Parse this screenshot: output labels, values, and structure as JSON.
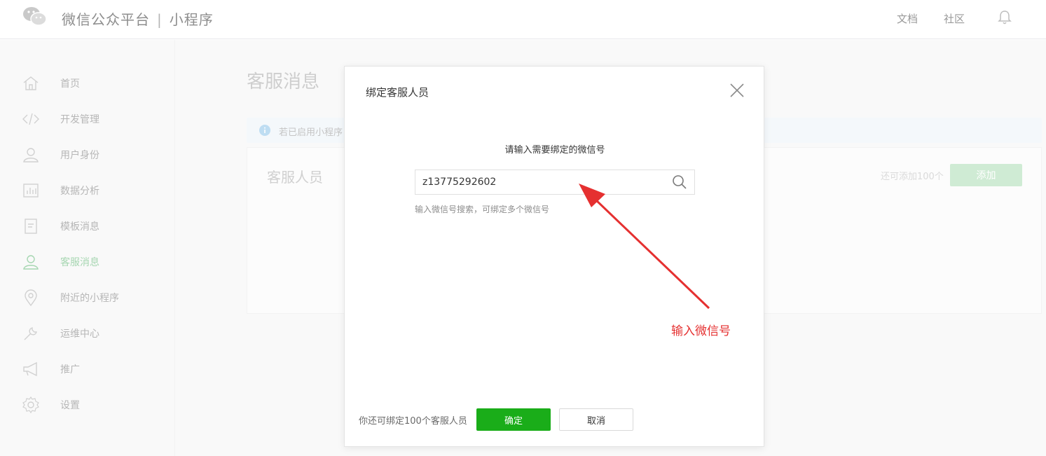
{
  "topbar": {
    "brand": "微信公众平台",
    "separator": "|",
    "section": "小程序",
    "links": [
      "文档",
      "社区"
    ],
    "icons": {
      "logo": "wechat-logo",
      "bell": "bell-icon"
    }
  },
  "sidebar": {
    "items": [
      {
        "label": "首页",
        "icon": "home-icon"
      },
      {
        "label": "开发管理",
        "icon": "code-icon"
      },
      {
        "label": "用户身份",
        "icon": "user-icon"
      },
      {
        "label": "数据分析",
        "icon": "chart-icon"
      },
      {
        "label": "模板消息",
        "icon": "document-icon"
      },
      {
        "label": "客服消息",
        "icon": "user-icon",
        "active": true
      },
      {
        "label": "附近的小程序",
        "icon": "location-icon"
      },
      {
        "label": "运维中心",
        "icon": "wrench-icon"
      },
      {
        "label": "推广",
        "icon": "megaphone-icon"
      },
      {
        "label": "设置",
        "icon": "gear-icon"
      }
    ],
    "active_color": "#77c188"
  },
  "main": {
    "title": "客服消息",
    "notice": "若已启用小程序",
    "card_title": "客服人员",
    "remaining": "还可添加100个",
    "add_label": "添加"
  },
  "dialog": {
    "title": "绑定客服人员",
    "prompt": "请输入需要绑定的微信号",
    "search_value": "z13775292602",
    "hint": "输入微信号搜索，可绑定多个微信号",
    "footer": "你还可绑定100个客服人员",
    "ok_label": "确定",
    "cancel_label": "取消",
    "ok_color": "#1aad19"
  },
  "annotation": {
    "text": "输入微信号",
    "color": "#e53030"
  }
}
